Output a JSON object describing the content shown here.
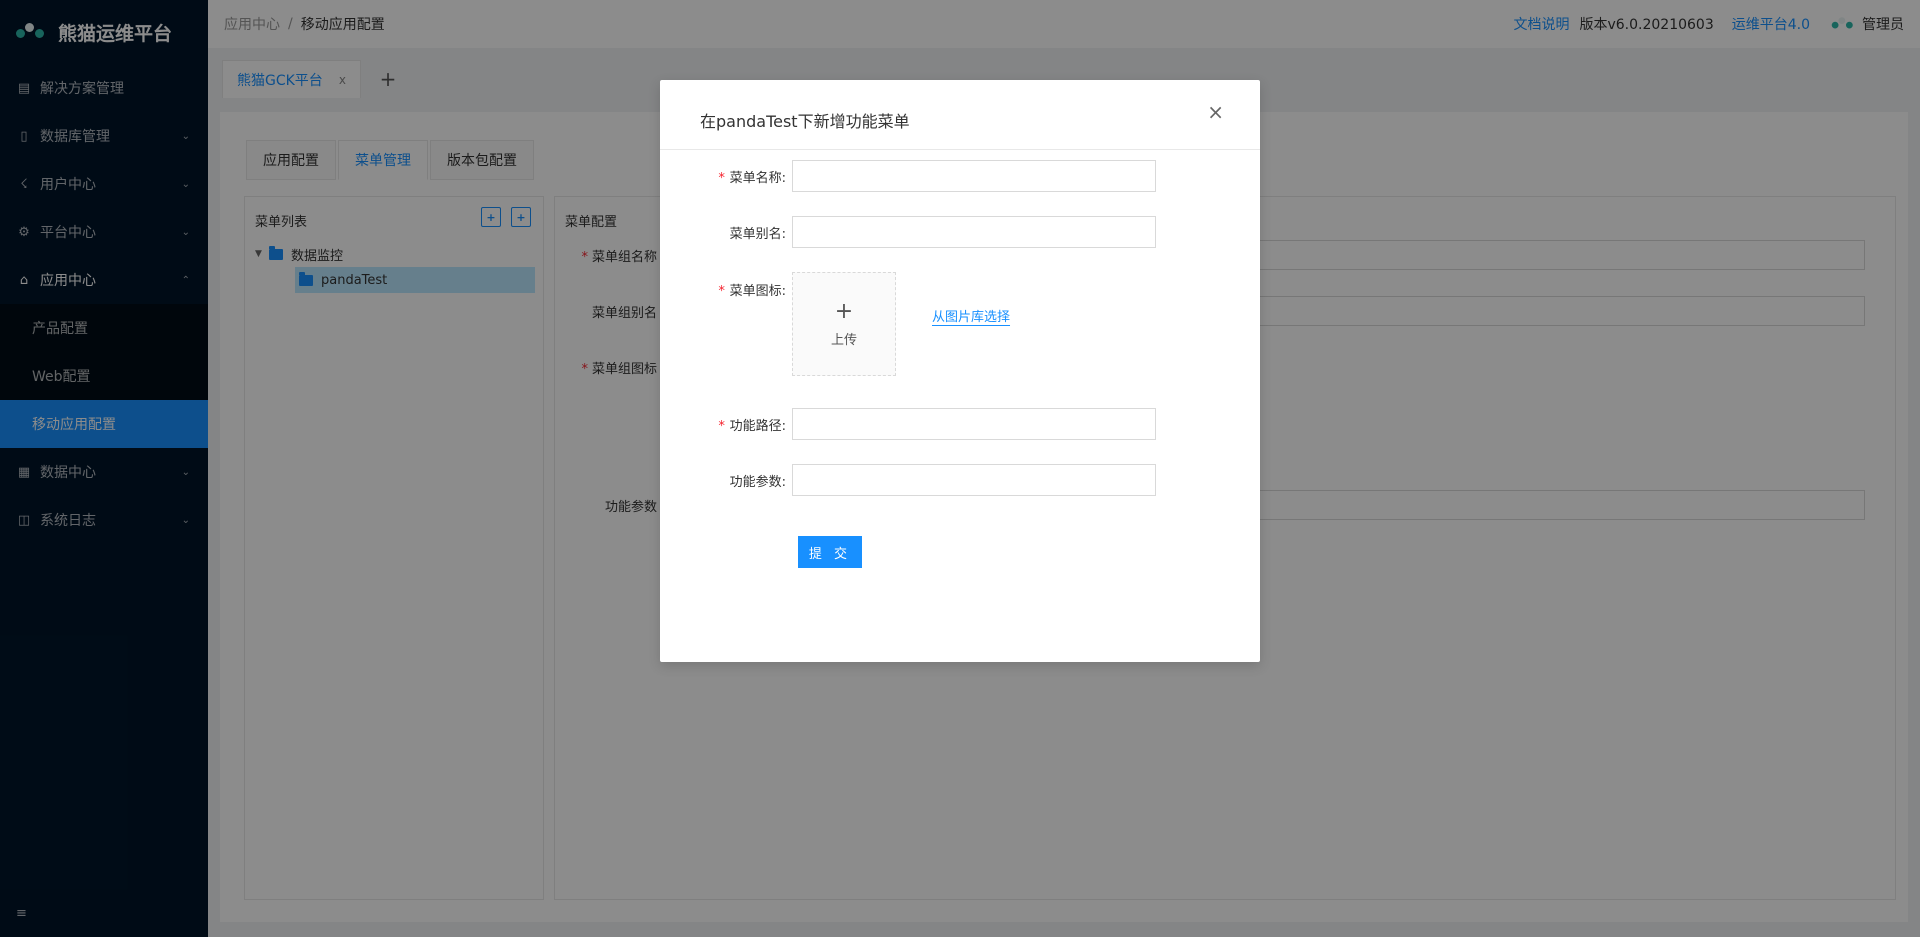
{
  "app": {
    "title": "熊猫运维平台"
  },
  "sidebar": {
    "items": [
      {
        "label": "解决方案管理",
        "icon": "document-icon",
        "has_children": false
      },
      {
        "label": "数据库管理",
        "icon": "database-icon",
        "has_children": true
      },
      {
        "label": "用户中心",
        "icon": "user-icon",
        "has_children": true
      },
      {
        "label": "平台中心",
        "icon": "gear-icon",
        "has_children": true
      },
      {
        "label": "应用中心",
        "icon": "home-icon",
        "has_children": true,
        "open": true
      },
      {
        "label": "数据中心",
        "icon": "table-icon",
        "has_children": true
      },
      {
        "label": "系统日志",
        "icon": "log-icon",
        "has_children": true
      }
    ],
    "submenu": [
      "产品配置",
      "Web配置",
      "移动应用配置"
    ],
    "active_submenu": "移动应用配置",
    "accent": "#1890ff",
    "background": "#001529"
  },
  "header": {
    "breadcrumb": [
      "应用中心",
      "移动应用配置"
    ],
    "separator": "/",
    "doc_link": "文档说明",
    "version": "版本v6.0.20210603",
    "platform_link": "运维平台4.0",
    "user": "管理员"
  },
  "page_tabs": {
    "active": "熊猫GCK平台",
    "close": "x",
    "add": "+"
  },
  "inner_tabs": [
    "应用配置",
    "菜单管理",
    "版本包配置"
  ],
  "inner_tab_active": "菜单管理",
  "left_panel": {
    "title": "菜单列表",
    "tree": {
      "root": "数据监控",
      "child": "pandaTest"
    }
  },
  "right_panel": {
    "title": "菜单配置",
    "fields": [
      "菜单组名称",
      "菜单组别名",
      "菜单组图标",
      "功能参数"
    ]
  },
  "modal": {
    "title": "在pandaTest下新增功能菜单",
    "close": "×",
    "fields": {
      "menu_name": {
        "label": "菜单名称:",
        "value": "",
        "required": true
      },
      "menu_alias": {
        "label": "菜单别名:",
        "value": "",
        "required": false
      },
      "menu_icon": {
        "label": "菜单图标:",
        "required": true,
        "upload": "上传",
        "plus": "+",
        "library_link": "从图片库选择"
      },
      "func_path": {
        "label": "功能路径:",
        "value": "",
        "required": true
      },
      "func_params": {
        "label": "功能参数:",
        "value": "",
        "required": false
      }
    },
    "required_mark": "*",
    "submit": "提 交"
  }
}
